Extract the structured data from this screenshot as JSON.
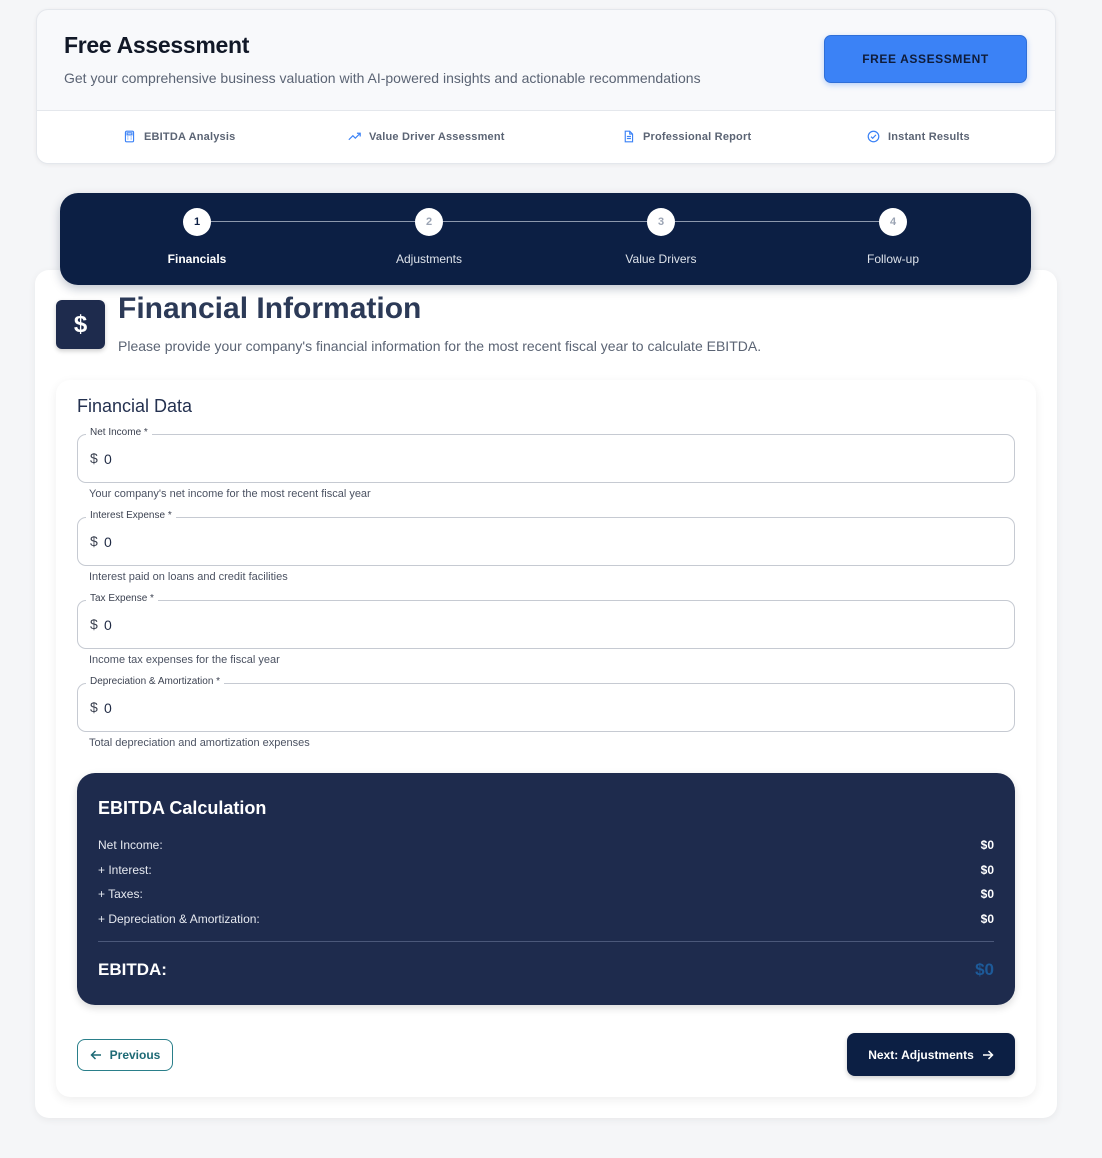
{
  "header": {
    "title": "Free Assessment",
    "subtitle": "Get your comprehensive business valuation with AI-powered insights and actionable recommendations",
    "cta_label": "FREE ASSESSMENT",
    "features": [
      {
        "label": "EBITDA Analysis",
        "icon": "calculator-icon"
      },
      {
        "label": "Value Driver Assessment",
        "icon": "trending-up-icon"
      },
      {
        "label": "Professional Report",
        "icon": "document-icon"
      },
      {
        "label": "Instant Results",
        "icon": "check-circle-icon"
      }
    ],
    "accent_color": "#3b82f6"
  },
  "stepper": {
    "current_step": 1,
    "steps": [
      {
        "number": "1",
        "label": "Financials"
      },
      {
        "number": "2",
        "label": "Adjustments"
      },
      {
        "number": "3",
        "label": "Value Drivers"
      },
      {
        "number": "4",
        "label": "Follow-up"
      }
    ]
  },
  "section": {
    "icon": "$",
    "title": "Financial Information",
    "subtitle": "Please provide your company's financial information for the most recent fiscal year to calculate EBITDA."
  },
  "form": {
    "title": "Financial Data",
    "fields": [
      {
        "label": "Net Income *",
        "prefix": "$",
        "value": "0",
        "help": "Your company's net income for the most recent fiscal year"
      },
      {
        "label": "Interest Expense *",
        "prefix": "$",
        "value": "0",
        "help": "Interest paid on loans and credit facilities"
      },
      {
        "label": "Tax Expense *",
        "prefix": "$",
        "value": "0",
        "help": "Income tax expenses for the fiscal year"
      },
      {
        "label": "Depreciation & Amortization *",
        "prefix": "$",
        "value": "0",
        "help": "Total depreciation and amortization expenses"
      }
    ]
  },
  "ebitda": {
    "title": "EBITDA Calculation",
    "rows": [
      {
        "label": "Net Income:",
        "value": "$0"
      },
      {
        "label": "+ Interest:",
        "value": "$0"
      },
      {
        "label": "+ Taxes:",
        "value": "$0"
      },
      {
        "label": "+ Depreciation & Amortization:",
        "value": "$0"
      }
    ],
    "total_label": "EBITDA:",
    "total_value": "$0"
  },
  "nav": {
    "previous_label": "Previous",
    "next_label": "Next: Adjustments"
  }
}
